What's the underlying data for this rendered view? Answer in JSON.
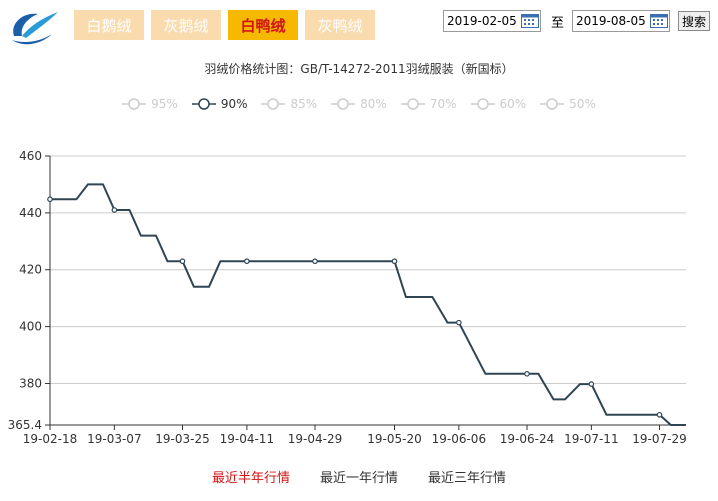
{
  "tabs": [
    {
      "label": "白鹅绒",
      "active": false
    },
    {
      "label": "灰鹅绒",
      "active": false
    },
    {
      "label": "白鸭绒",
      "active": true
    },
    {
      "label": "灰鸭绒",
      "active": false
    }
  ],
  "date_filter": {
    "start": "2019-02-05",
    "separator": "至",
    "end": "2019-08-05",
    "search_label": "搜索"
  },
  "range_links": [
    {
      "label": "最近半年行情",
      "active": true
    },
    {
      "label": "最近一年行情",
      "active": false
    },
    {
      "label": "最近三年行情",
      "active": false
    }
  ],
  "colors": {
    "line": "#2f4554",
    "active_tab": "#f7b900",
    "inactive_tab": "#f9dbae",
    "active_text": "#d11414",
    "grid": "#cccccc"
  },
  "chart_data": {
    "type": "line",
    "title": "羽绒价格统计图：GB/T-14272-2011羽绒服装（新国标）",
    "legend": [
      "95%",
      "90%",
      "85%",
      "80%",
      "70%",
      "60%",
      "50%"
    ],
    "legend_selected": "90%",
    "legend_position": "top-center",
    "grid": true,
    "ylim": [
      365.4,
      460
    ],
    "y_ticks": [
      "460",
      "440",
      "420",
      "400",
      "380",
      "365.4"
    ],
    "x_tick_labels": [
      "19-02-18",
      "19-03-07",
      "19-03-25",
      "19-04-11",
      "19-04-29",
      "19-05-20",
      "19-06-06",
      "19-06-24",
      "19-07-11",
      "19-07-29"
    ],
    "series": [
      {
        "name": "90%",
        "points": [
          {
            "x": "19-02-18",
            "y": 444.8,
            "m": true
          },
          {
            "x": "19-02-21",
            "y": 444.8
          },
          {
            "x": "19-02-25",
            "y": 444.8
          },
          {
            "x": "19-02-28",
            "y": 450
          },
          {
            "x": "19-03-04",
            "y": 450
          },
          {
            "x": "19-03-07",
            "y": 441,
            "m": true
          },
          {
            "x": "19-03-11",
            "y": 441
          },
          {
            "x": "19-03-14",
            "y": 432
          },
          {
            "x": "19-03-18",
            "y": 432
          },
          {
            "x": "19-03-21",
            "y": 423
          },
          {
            "x": "19-03-25",
            "y": 423,
            "m": true
          },
          {
            "x": "19-03-28",
            "y": 414
          },
          {
            "x": "19-04-01",
            "y": 414
          },
          {
            "x": "19-04-04",
            "y": 423
          },
          {
            "x": "19-04-08",
            "y": 423
          },
          {
            "x": "19-04-11",
            "y": 423,
            "m": true
          },
          {
            "x": "19-04-29",
            "y": 423,
            "m": true
          },
          {
            "x": "19-05-20",
            "y": 423,
            "m": true
          },
          {
            "x": "19-05-23",
            "y": 410.4
          },
          {
            "x": "19-05-27",
            "y": 410.4
          },
          {
            "x": "19-05-30",
            "y": 410.4
          },
          {
            "x": "19-06-03",
            "y": 401.4
          },
          {
            "x": "19-06-06",
            "y": 401.4,
            "m": true
          },
          {
            "x": "19-06-13",
            "y": 383.4
          },
          {
            "x": "19-06-17",
            "y": 383.4
          },
          {
            "x": "19-06-20",
            "y": 383.4
          },
          {
            "x": "19-06-24",
            "y": 383.4,
            "m": true
          },
          {
            "x": "19-06-27",
            "y": 383.4
          },
          {
            "x": "19-07-01",
            "y": 374.4
          },
          {
            "x": "19-07-04",
            "y": 374.4
          },
          {
            "x": "19-07-08",
            "y": 379.8
          },
          {
            "x": "19-07-11",
            "y": 379.8,
            "m": true
          },
          {
            "x": "19-07-15",
            "y": 369
          },
          {
            "x": "19-07-18",
            "y": 369
          },
          {
            "x": "19-07-22",
            "y": 369
          },
          {
            "x": "19-07-25",
            "y": 369
          },
          {
            "x": "19-07-29",
            "y": 369,
            "m": true
          },
          {
            "x": "19-08-01",
            "y": 365.4
          },
          {
            "x": "19-08-05",
            "y": 365.4
          }
        ]
      }
    ]
  }
}
